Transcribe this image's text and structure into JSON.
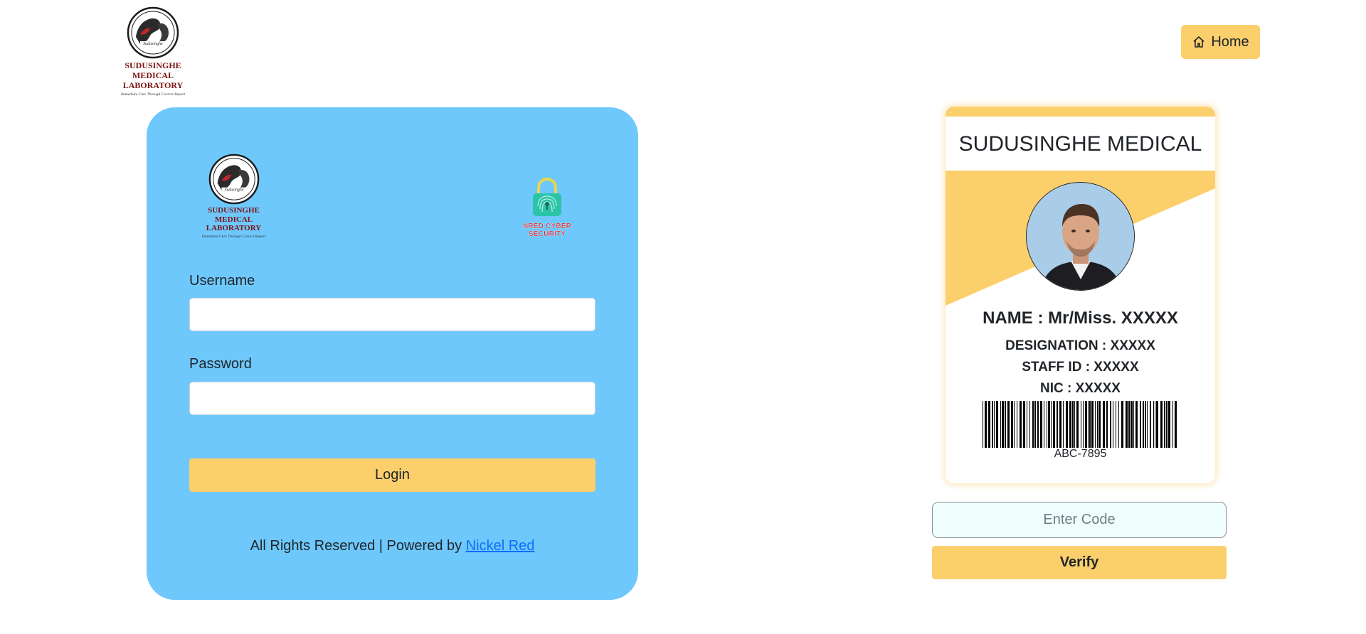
{
  "header": {
    "logo": {
      "brand_line1": "SUDUSINGHE MEDICAL",
      "brand_line2": "LABORATORY",
      "emblem_text": "Sudusinghe",
      "tagline": "Immediate Cure Through Correct Report"
    },
    "home_button": {
      "label": "Home",
      "icon": "house-icon"
    }
  },
  "login": {
    "logo": {
      "brand_line1": "SUDUSINGHE MEDICAL",
      "brand_line2": "LABORATORY",
      "emblem_text": "Sudusinghe",
      "tagline": "Immediate Cure Through Correct Report"
    },
    "security_logo": {
      "text": "NRED CYBER SECURITY",
      "icon": "padlock-fingerprint-icon"
    },
    "username_label": "Username",
    "username_value": "",
    "password_label": "Password",
    "password_value": "",
    "login_button": "Login",
    "footer_prefix": "All Rights Reserved | Powered by ",
    "footer_link": "Nickel Red"
  },
  "id_card": {
    "title": "SUDUSINGHE MEDICAL",
    "name": "NAME : Mr/Miss. XXXXX",
    "designation": "DESIGNATION : XXXXX",
    "staff_id": "STAFF ID : XXXXX",
    "nic": "NIC : XXXXX",
    "barcode_code": "ABC-7895",
    "accent_color": "#fbcf6c"
  },
  "verify": {
    "code_placeholder": "Enter Code",
    "code_value": "",
    "button": "Verify"
  },
  "colors": {
    "panel": "#6ec8fc",
    "button": "#fbcf6c",
    "link": "#0d6efd"
  }
}
